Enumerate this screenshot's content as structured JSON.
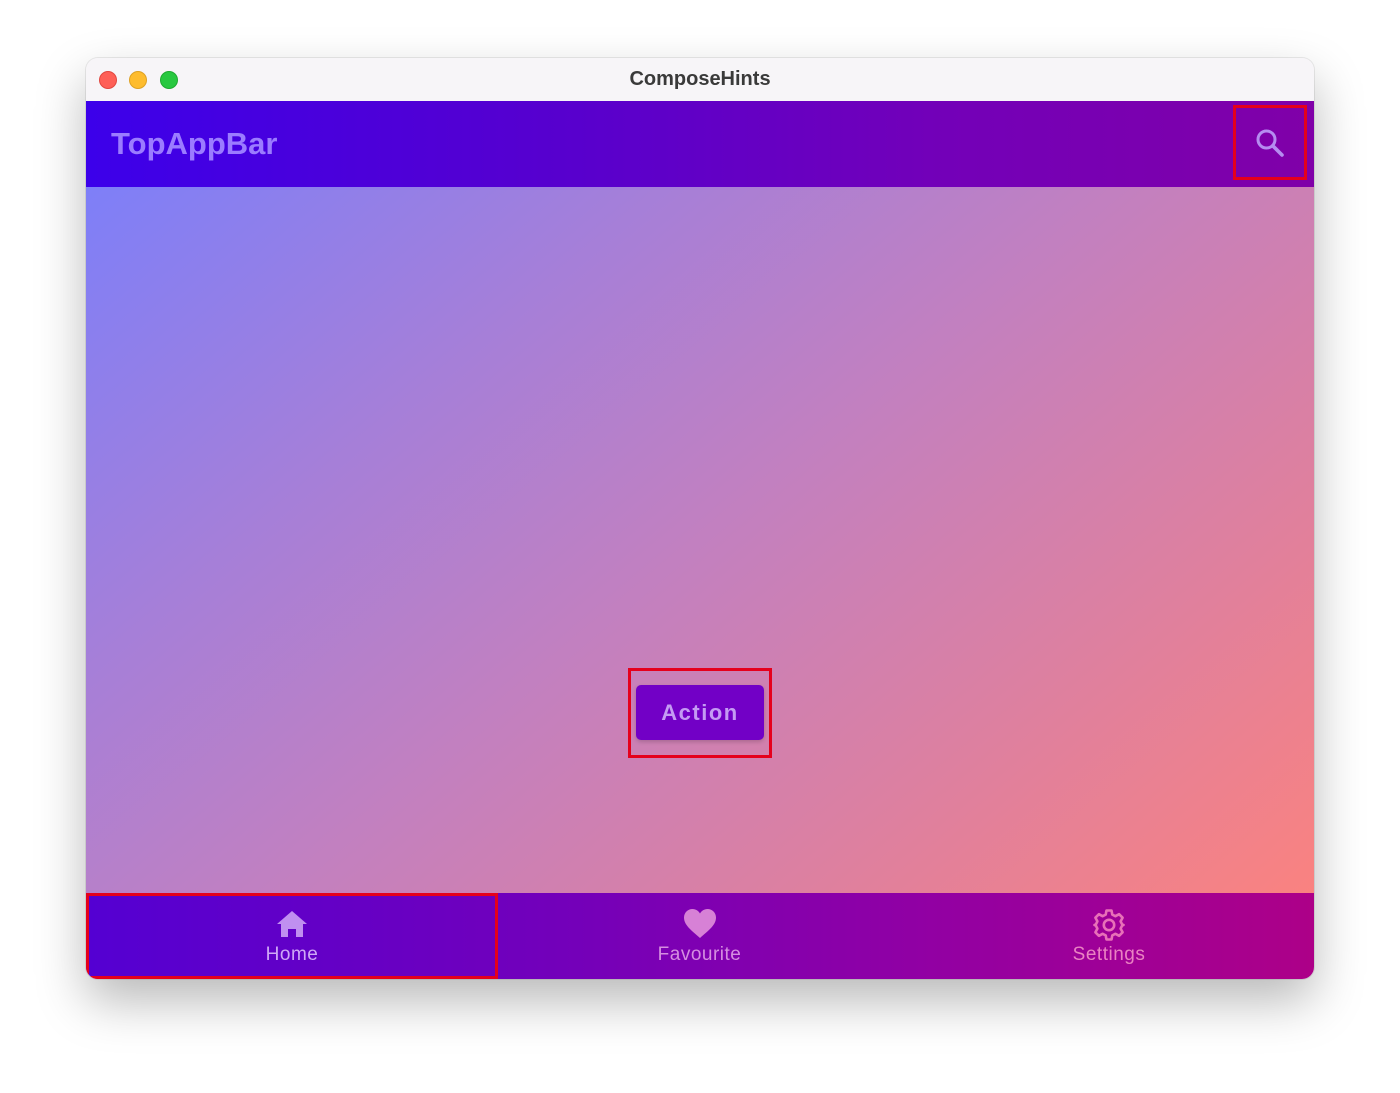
{
  "window": {
    "title": "ComposeHints"
  },
  "top_app_bar": {
    "title": "TopAppBar",
    "search_icon": "search-icon"
  },
  "main": {
    "action_label": "Action"
  },
  "bottom_nav": {
    "items": [
      {
        "label": "Home",
        "icon": "home-icon",
        "selected": true
      },
      {
        "label": "Favourite",
        "icon": "heart-icon",
        "selected": false
      },
      {
        "label": "Settings",
        "icon": "gear-icon",
        "selected": false
      }
    ]
  },
  "colors": {
    "highlight_border": "#e5001c",
    "top_bar_start": "#3c00ea",
    "top_bar_end": "#8000a8",
    "button_fill": "#7200c6",
    "content_gradient_start": "#7e7ff8",
    "content_gradient_end": "#fa8280"
  }
}
